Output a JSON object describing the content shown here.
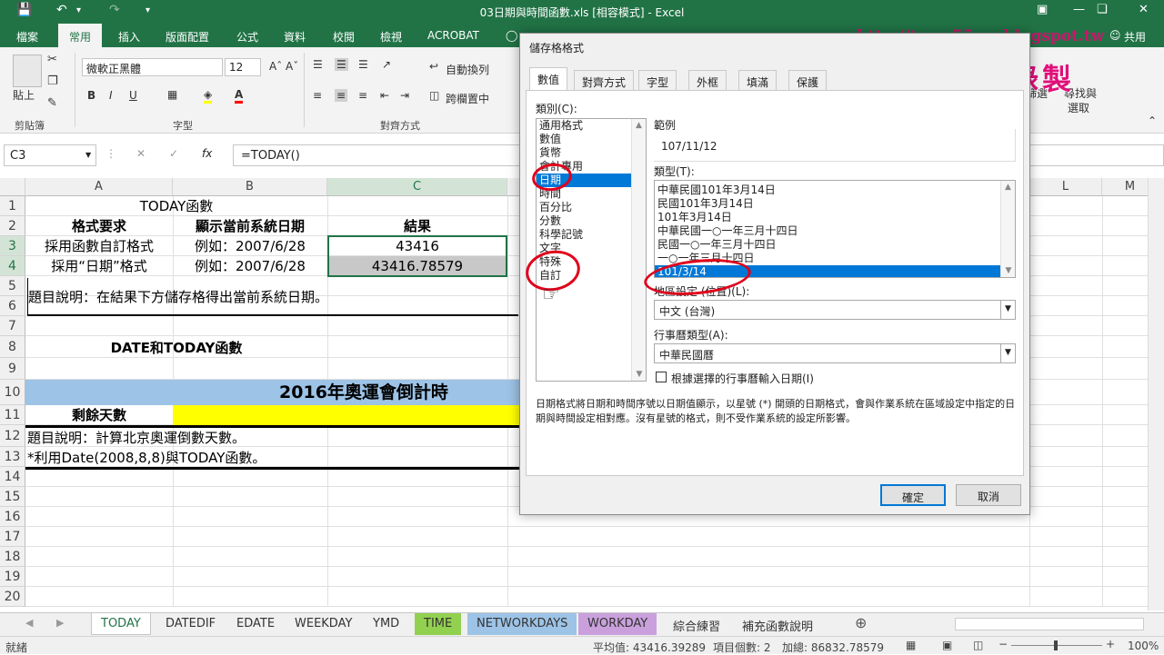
{
  "window": {
    "title": "03日期與時間函數.xls [相容模式] - Excel"
  },
  "ribbon_tabs": [
    "檔案",
    "常用",
    "插入",
    "版面配置",
    "公式",
    "資料",
    "校閱",
    "檢視",
    "ACROBAT"
  ],
  "ribbon": {
    "paste": "貼上",
    "clipboard": "剪貼簿",
    "font_name": "微軟正黑體",
    "font_size": "12",
    "font_group": "字型",
    "wrap": "自動換列",
    "merge": "跨欄置中",
    "align_group": "對齊方式",
    "filter": "篩選",
    "find": "尋找與",
    "find2": "選取",
    "share": "共用"
  },
  "formula_bar": {
    "name_box": "C3",
    "formula": "=TODAY()"
  },
  "watermark": {
    "url": "http://terry55wu.blogspot.tw",
    "author": "吳清輝老師錄製"
  },
  "columns": [
    "A",
    "B",
    "C",
    "L",
    "M"
  ],
  "rows": [
    "1",
    "2",
    "3",
    "4",
    "5",
    "6",
    "7",
    "8",
    "9",
    "10",
    "11",
    "12",
    "13",
    "14",
    "15",
    "16",
    "17",
    "18",
    "19",
    "20"
  ],
  "cells": {
    "r1": "TODAY函數",
    "r2a": "格式要求",
    "r2b": "顯示當前系統日期",
    "r2c": "結果",
    "r3a": "採用函數自訂格式",
    "r3b": "例如：2007/6/28",
    "r3c": "43416",
    "r4a": "採用“日期”格式",
    "r4b": "例如：2007/6/28",
    "r4c": "43416.78579",
    "r5": "題目說明：在結果下方儲存格得出當前系統日期。",
    "r8": "DATE和TODAY函數",
    "r10": "2016年奧運會倒計時",
    "r11": "剩餘天數",
    "r12": "題目說明：計算北京奧運倒數天數。",
    "r13": "*利用Date(2008,8,8)與TODAY函數。"
  },
  "sheet_tabs": [
    {
      "label": "TODAY",
      "color": "#ffffff"
    },
    {
      "label": "DATEDIF",
      "color": ""
    },
    {
      "label": "EDATE",
      "color": ""
    },
    {
      "label": "WEEKDAY",
      "color": ""
    },
    {
      "label": "YMD",
      "color": ""
    },
    {
      "label": "TIME",
      "color": "#92d050"
    },
    {
      "label": "NETWORKDAYS",
      "color": "#9dc3e6"
    },
    {
      "label": "WORKDAY",
      "color": "#c9a0dc"
    },
    {
      "label": "綜合練習",
      "color": ""
    },
    {
      "label": "補充函數說明",
      "color": ""
    }
  ],
  "status": {
    "ready": "就緒",
    "average": "平均值: 43416.39289",
    "count": "項目個數: 2",
    "sum": "加總: 86832.78579",
    "zoom": "100%"
  },
  "dialog": {
    "title": "儲存格格式",
    "tabs": [
      "數值",
      "對齊方式",
      "字型",
      "外框",
      "填滿",
      "保護"
    ],
    "category_label": "類別(C):",
    "categories": [
      "通用格式",
      "數值",
      "貨幣",
      "會計專用",
      "日期",
      "時間",
      "百分比",
      "分數",
      "科學記號",
      "文字",
      "特殊",
      "自訂"
    ],
    "selected_category": "日期",
    "sample_label": "範例",
    "sample_value": "107/11/12",
    "type_label": "類型(T):",
    "types": [
      "中華民國101年3月14日",
      "民國101年3月14日",
      "101年3月14日",
      "中華民國一○一年三月十四日",
      "民國一○一年三月十四日",
      "一○一年三月十四日",
      "101/3/14"
    ],
    "selected_type": "101/3/14",
    "locale_label": "地區設定 (位置)(L):",
    "locale_value": "中文 (台灣)",
    "calendar_label": "行事曆類型(A):",
    "calendar_value": "中華民國曆",
    "checkbox_label": "根據選擇的行事曆輸入日期(I)",
    "description": "日期格式將日期和時間序號以日期值顯示，以星號 (*) 開頭的日期格式，會與作業系統在區域設定中指定的日期與時間設定相對應。沒有星號的格式，則不受作業系統的設定所影響。",
    "ok": "確定",
    "cancel": "取消"
  }
}
